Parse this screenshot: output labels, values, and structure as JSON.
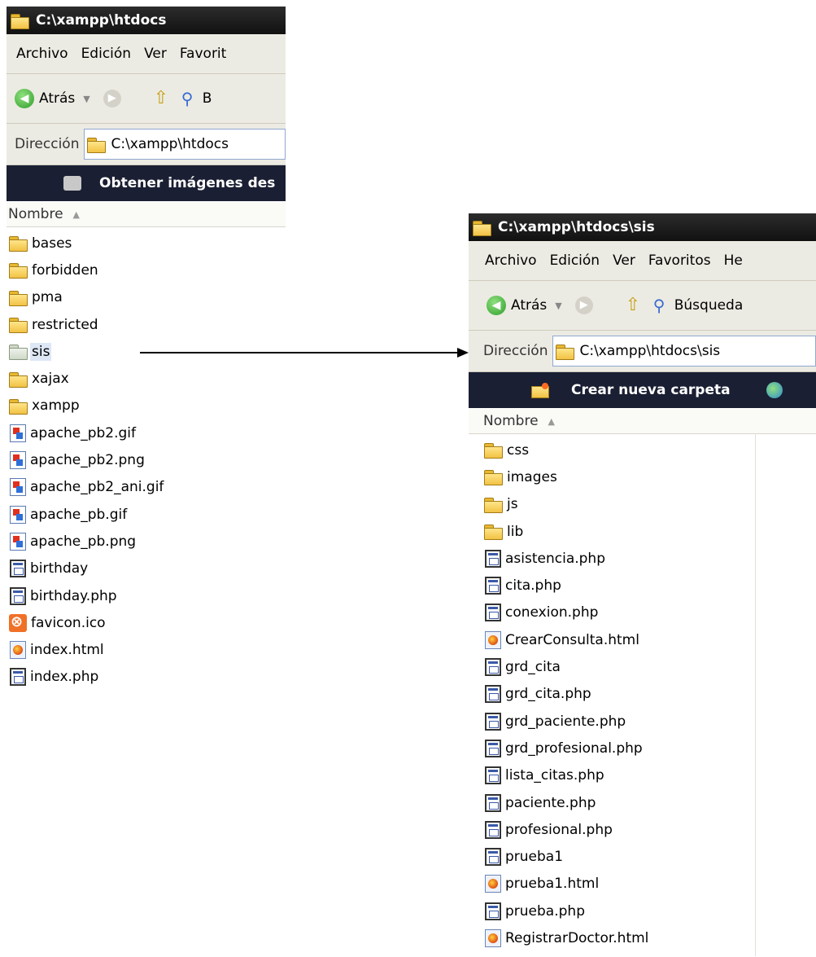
{
  "left_window": {
    "title": "C:\\xampp\\htdocs",
    "menu": [
      "Archivo",
      "Edición",
      "Ver",
      "Favorit"
    ],
    "toolbar": {
      "back_label": "Atrás",
      "search_label": "B"
    },
    "address": {
      "label": "Dirección",
      "path": "C:\\xampp\\htdocs"
    },
    "task": {
      "label": "Obtener imágenes des"
    },
    "column_header": "Nombre",
    "items": [
      {
        "name": "bases",
        "icon": "folder-icon"
      },
      {
        "name": "forbidden",
        "icon": "folder-icon"
      },
      {
        "name": "pma",
        "icon": "folder-icon"
      },
      {
        "name": "restricted",
        "icon": "folder-icon"
      },
      {
        "name": "sis",
        "icon": "folder-icon",
        "selected": true
      },
      {
        "name": "xajax",
        "icon": "folder-icon"
      },
      {
        "name": "xampp",
        "icon": "folder-icon"
      },
      {
        "name": "apache_pb2.gif",
        "icon": "image-file-icon"
      },
      {
        "name": "apache_pb2.png",
        "icon": "image-file-icon"
      },
      {
        "name": "apache_pb2_ani.gif",
        "icon": "image-file-icon"
      },
      {
        "name": "apache_pb.gif",
        "icon": "image-file-icon"
      },
      {
        "name": "apache_pb.png",
        "icon": "image-file-icon"
      },
      {
        "name": "birthday",
        "icon": "php-file-icon"
      },
      {
        "name": "birthday.php",
        "icon": "php-file-icon"
      },
      {
        "name": "favicon.ico",
        "icon": "xampp-ico-icon"
      },
      {
        "name": "index.html",
        "icon": "html-file-icon"
      },
      {
        "name": "index.php",
        "icon": "php-file-icon"
      }
    ]
  },
  "right_window": {
    "title": "C:\\xampp\\htdocs\\sis",
    "menu": [
      "Archivo",
      "Edición",
      "Ver",
      "Favoritos",
      "He"
    ],
    "toolbar": {
      "back_label": "Atrás",
      "search_label": "Búsqueda"
    },
    "address": {
      "label": "Dirección",
      "path": "C:\\xampp\\htdocs\\sis"
    },
    "task": {
      "label": "Crear nueva carpeta"
    },
    "column_header": "Nombre",
    "items": [
      {
        "name": "css",
        "icon": "folder-icon"
      },
      {
        "name": "images",
        "icon": "folder-icon"
      },
      {
        "name": "js",
        "icon": "folder-icon"
      },
      {
        "name": "lib",
        "icon": "folder-icon"
      },
      {
        "name": "asistencia.php",
        "icon": "php-file-icon"
      },
      {
        "name": "cita.php",
        "icon": "php-file-icon"
      },
      {
        "name": "conexion.php",
        "icon": "php-file-icon"
      },
      {
        "name": "CrearConsulta.html",
        "icon": "html-file-icon"
      },
      {
        "name": "grd_cita",
        "icon": "php-file-icon"
      },
      {
        "name": "grd_cita.php",
        "icon": "php-file-icon"
      },
      {
        "name": "grd_paciente.php",
        "icon": "php-file-icon"
      },
      {
        "name": "grd_profesional.php",
        "icon": "php-file-icon"
      },
      {
        "name": "lista_citas.php",
        "icon": "php-file-icon"
      },
      {
        "name": "paciente.php",
        "icon": "php-file-icon"
      },
      {
        "name": "profesional.php",
        "icon": "php-file-icon"
      },
      {
        "name": "prueba1",
        "icon": "php-file-icon"
      },
      {
        "name": "prueba1.html",
        "icon": "html-file-icon"
      },
      {
        "name": "prueba.php",
        "icon": "php-file-icon"
      },
      {
        "name": "RegistrarDoctor.html",
        "icon": "html-file-icon"
      }
    ]
  }
}
